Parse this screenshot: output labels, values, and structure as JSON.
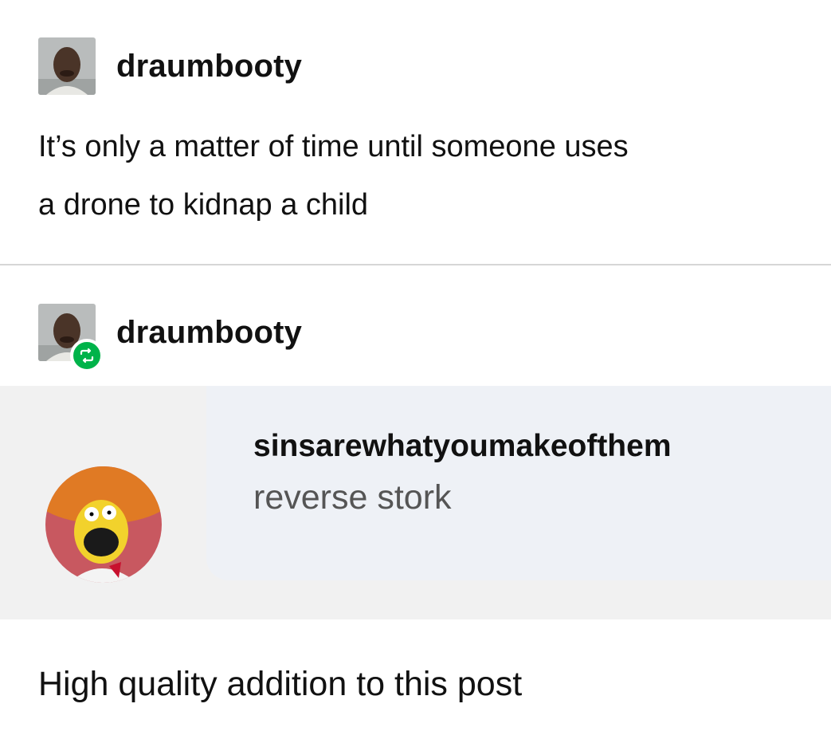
{
  "post": {
    "username": "draumbooty",
    "text_line1": "It’s only a matter of time until someone uses",
    "text_line2": "a drone to kidnap a child"
  },
  "reblog": {
    "username": "draumbooty",
    "badge_icon": "reblog-icon",
    "badge_color": "#00b34a",
    "comment": {
      "author": "sinsarewhatyoumakeofthem",
      "text": "reverse stork"
    },
    "addition_text": "High quality addition to this post"
  }
}
